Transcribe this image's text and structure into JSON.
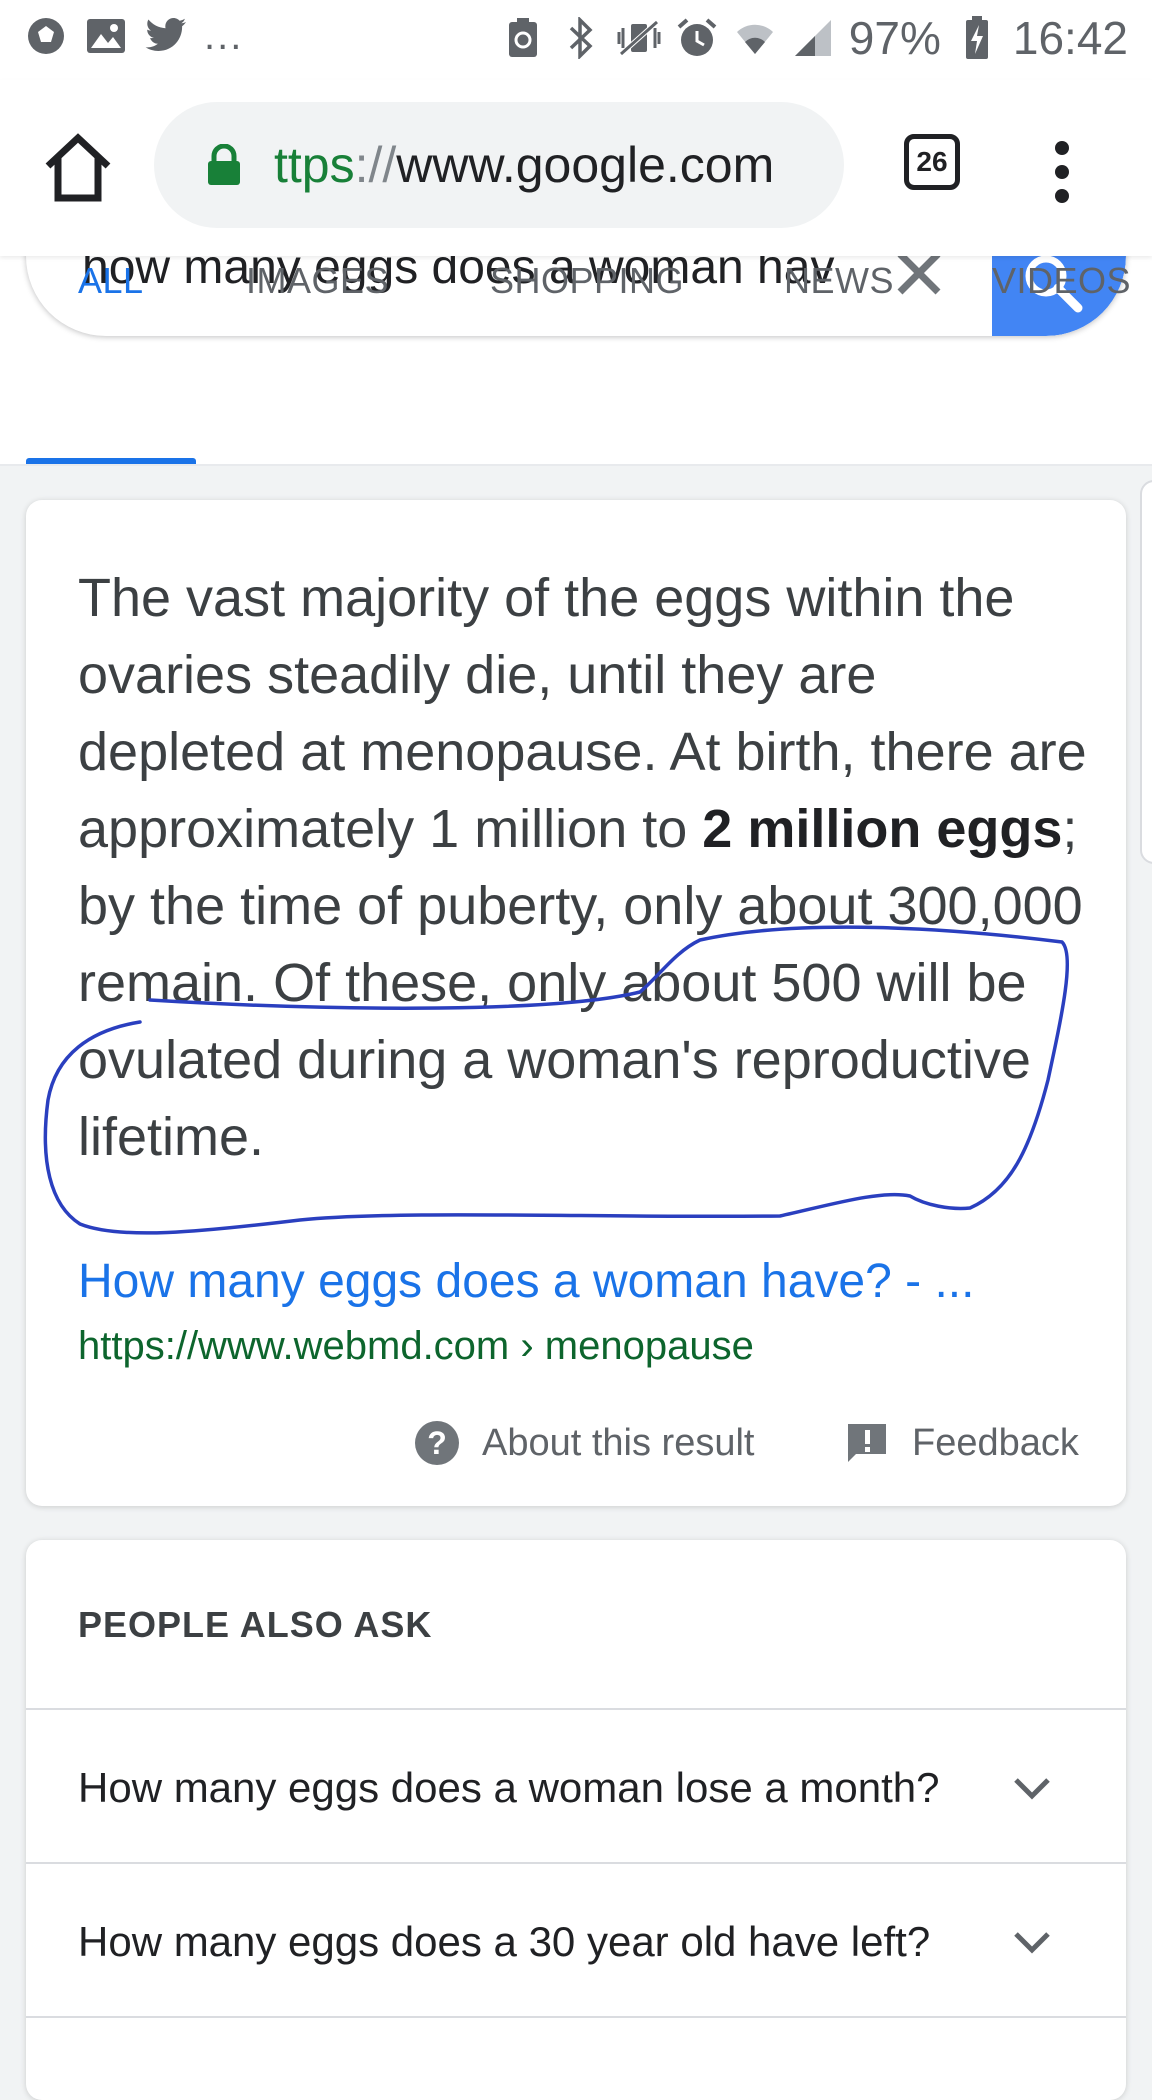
{
  "status_bar": {
    "notification_icons": [
      "soccer-ball-icon",
      "image-icon",
      "twitter-icon"
    ],
    "overflow": "...",
    "system_icons": [
      "recycle-badge-icon",
      "bluetooth-icon",
      "vibrate-icon",
      "alarm-icon",
      "wifi-icon",
      "signal-icon"
    ],
    "battery": "97%",
    "time": "16:42"
  },
  "browser": {
    "url_scheme": "ttps",
    "url_sep": "://",
    "url_host": "www.google.com",
    "tab_count": "26"
  },
  "search": {
    "query": "how many eggs does a woman hav",
    "accent": "#4285f4"
  },
  "tabs": [
    {
      "label": "ALL",
      "active": true
    },
    {
      "label": "IMAGES",
      "active": false
    },
    {
      "label": "SHOPPING",
      "active": false
    },
    {
      "label": "NEWS",
      "active": false
    },
    {
      "label": "VIDEOS",
      "active": false
    }
  ],
  "featured_snippet": {
    "text_part1": "The vast majority of the eggs within the ovaries steadily die, until they are depleted at menopause. At birth, there are approximately 1 million to ",
    "bold1": "2 million eggs",
    "text_part2": "; by the time of puberty, only about 300,000 remain. Of these, only about 500 will be ovulated during a woman's reproductive lifetime.",
    "result_title": "How many eggs does a woman have? - ...",
    "result_url": "https://www.webmd.com › menopause",
    "about_label": "About this result",
    "feedback_label": "Feedback"
  },
  "people_also_ask": {
    "header": "PEOPLE ALSO ASK",
    "questions": [
      "How many eggs does a woman lose a month?",
      "How many eggs does a 30 year old have left?"
    ]
  },
  "annotation_color": "#2a3fbf"
}
